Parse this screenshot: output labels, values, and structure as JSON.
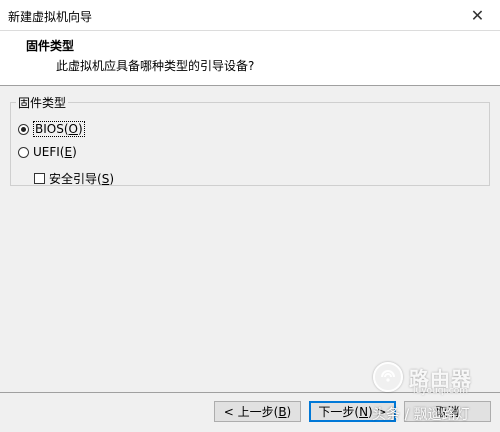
{
  "window": {
    "title": "新建虚拟机向导",
    "close_glyph": "✕"
  },
  "header": {
    "title": "固件类型",
    "subtitle": "此虚拟机应具备哪种类型的引导设备?"
  },
  "firmware_group": {
    "legend": "固件类型",
    "options": [
      {
        "label_prefix": "BIOS(",
        "hotkey": "O",
        "label_suffix": ")",
        "selected": true
      },
      {
        "label_prefix": "UEFI(",
        "hotkey": "E",
        "label_suffix": ")",
        "selected": false
      }
    ],
    "secure_boot": {
      "label_prefix": "安全引导(",
      "hotkey": "S",
      "label_suffix": ")",
      "checked": false
    }
  },
  "buttons": {
    "back": {
      "prefix": "< 上一步(",
      "hotkey": "B",
      "suffix": ")"
    },
    "next": {
      "prefix": "下一步(",
      "hotkey": "N",
      "suffix": ") >"
    },
    "cancel": "取消"
  },
  "watermark": {
    "brand": "路由器",
    "domain": "luyouqi.com",
    "caption": "头条 / 飘遥路灯"
  }
}
